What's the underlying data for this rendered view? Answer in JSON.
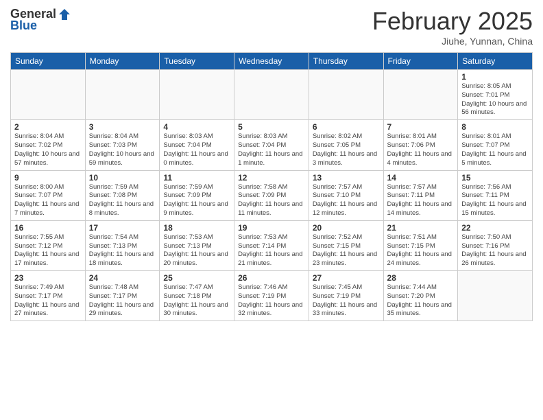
{
  "logo": {
    "general": "General",
    "blue": "Blue"
  },
  "header": {
    "month": "February 2025",
    "location": "Jiuhe, Yunnan, China"
  },
  "weekdays": [
    "Sunday",
    "Monday",
    "Tuesday",
    "Wednesday",
    "Thursday",
    "Friday",
    "Saturday"
  ],
  "weeks": [
    [
      {
        "day": "",
        "info": ""
      },
      {
        "day": "",
        "info": ""
      },
      {
        "day": "",
        "info": ""
      },
      {
        "day": "",
        "info": ""
      },
      {
        "day": "",
        "info": ""
      },
      {
        "day": "",
        "info": ""
      },
      {
        "day": "1",
        "info": "Sunrise: 8:05 AM\nSunset: 7:01 PM\nDaylight: 10 hours\nand 56 minutes."
      }
    ],
    [
      {
        "day": "2",
        "info": "Sunrise: 8:04 AM\nSunset: 7:02 PM\nDaylight: 10 hours\nand 57 minutes."
      },
      {
        "day": "3",
        "info": "Sunrise: 8:04 AM\nSunset: 7:03 PM\nDaylight: 10 hours\nand 59 minutes."
      },
      {
        "day": "4",
        "info": "Sunrise: 8:03 AM\nSunset: 7:04 PM\nDaylight: 11 hours\nand 0 minutes."
      },
      {
        "day": "5",
        "info": "Sunrise: 8:03 AM\nSunset: 7:04 PM\nDaylight: 11 hours\nand 1 minute."
      },
      {
        "day": "6",
        "info": "Sunrise: 8:02 AM\nSunset: 7:05 PM\nDaylight: 11 hours\nand 3 minutes."
      },
      {
        "day": "7",
        "info": "Sunrise: 8:01 AM\nSunset: 7:06 PM\nDaylight: 11 hours\nand 4 minutes."
      },
      {
        "day": "8",
        "info": "Sunrise: 8:01 AM\nSunset: 7:07 PM\nDaylight: 11 hours\nand 5 minutes."
      }
    ],
    [
      {
        "day": "9",
        "info": "Sunrise: 8:00 AM\nSunset: 7:07 PM\nDaylight: 11 hours\nand 7 minutes."
      },
      {
        "day": "10",
        "info": "Sunrise: 7:59 AM\nSunset: 7:08 PM\nDaylight: 11 hours\nand 8 minutes."
      },
      {
        "day": "11",
        "info": "Sunrise: 7:59 AM\nSunset: 7:09 PM\nDaylight: 11 hours\nand 9 minutes."
      },
      {
        "day": "12",
        "info": "Sunrise: 7:58 AM\nSunset: 7:09 PM\nDaylight: 11 hours\nand 11 minutes."
      },
      {
        "day": "13",
        "info": "Sunrise: 7:57 AM\nSunset: 7:10 PM\nDaylight: 11 hours\nand 12 minutes."
      },
      {
        "day": "14",
        "info": "Sunrise: 7:57 AM\nSunset: 7:11 PM\nDaylight: 11 hours\nand 14 minutes."
      },
      {
        "day": "15",
        "info": "Sunrise: 7:56 AM\nSunset: 7:11 PM\nDaylight: 11 hours\nand 15 minutes."
      }
    ],
    [
      {
        "day": "16",
        "info": "Sunrise: 7:55 AM\nSunset: 7:12 PM\nDaylight: 11 hours\nand 17 minutes."
      },
      {
        "day": "17",
        "info": "Sunrise: 7:54 AM\nSunset: 7:13 PM\nDaylight: 11 hours\nand 18 minutes."
      },
      {
        "day": "18",
        "info": "Sunrise: 7:53 AM\nSunset: 7:13 PM\nDaylight: 11 hours\nand 20 minutes."
      },
      {
        "day": "19",
        "info": "Sunrise: 7:53 AM\nSunset: 7:14 PM\nDaylight: 11 hours\nand 21 minutes."
      },
      {
        "day": "20",
        "info": "Sunrise: 7:52 AM\nSunset: 7:15 PM\nDaylight: 11 hours\nand 23 minutes."
      },
      {
        "day": "21",
        "info": "Sunrise: 7:51 AM\nSunset: 7:15 PM\nDaylight: 11 hours\nand 24 minutes."
      },
      {
        "day": "22",
        "info": "Sunrise: 7:50 AM\nSunset: 7:16 PM\nDaylight: 11 hours\nand 26 minutes."
      }
    ],
    [
      {
        "day": "23",
        "info": "Sunrise: 7:49 AM\nSunset: 7:17 PM\nDaylight: 11 hours\nand 27 minutes."
      },
      {
        "day": "24",
        "info": "Sunrise: 7:48 AM\nSunset: 7:17 PM\nDaylight: 11 hours\nand 29 minutes."
      },
      {
        "day": "25",
        "info": "Sunrise: 7:47 AM\nSunset: 7:18 PM\nDaylight: 11 hours\nand 30 minutes."
      },
      {
        "day": "26",
        "info": "Sunrise: 7:46 AM\nSunset: 7:19 PM\nDaylight: 11 hours\nand 32 minutes."
      },
      {
        "day": "27",
        "info": "Sunrise: 7:45 AM\nSunset: 7:19 PM\nDaylight: 11 hours\nand 33 minutes."
      },
      {
        "day": "28",
        "info": "Sunrise: 7:44 AM\nSunset: 7:20 PM\nDaylight: 11 hours\nand 35 minutes."
      },
      {
        "day": "",
        "info": ""
      }
    ]
  ]
}
